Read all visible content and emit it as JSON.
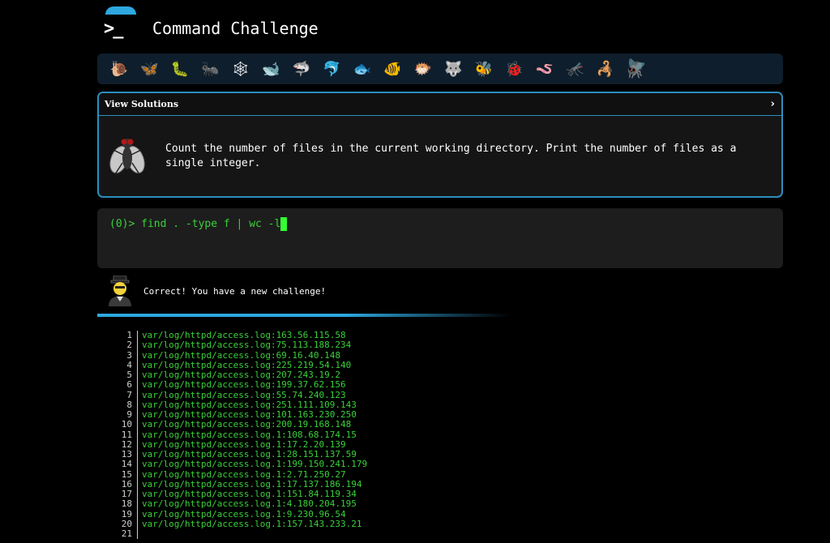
{
  "header": {
    "logo": ">_",
    "title": "Command Challenge"
  },
  "levels": [
    {
      "icon": "snail-icon",
      "glyph": "🐌"
    },
    {
      "icon": "butterfly-icon",
      "glyph": "🦋"
    },
    {
      "icon": "caterpillar-icon",
      "glyph": "🐛"
    },
    {
      "icon": "ant-icon",
      "glyph": "🐜"
    },
    {
      "icon": "web-icon",
      "glyph": "🕸"
    },
    {
      "icon": "whale-icon",
      "glyph": "🐋"
    },
    {
      "icon": "shark-icon",
      "glyph": "🦈"
    },
    {
      "icon": "dolphin-icon",
      "glyph": "🐬"
    },
    {
      "icon": "fish-icon",
      "glyph": "🐟"
    },
    {
      "icon": "tropical-fish-icon",
      "glyph": "🐠"
    },
    {
      "icon": "blowfish-icon",
      "glyph": "🐡"
    },
    {
      "icon": "wolf-icon",
      "glyph": "🐺"
    },
    {
      "icon": "bee-icon",
      "glyph": "🐝"
    },
    {
      "icon": "ladybug-icon",
      "glyph": "🐞"
    },
    {
      "icon": "worm-icon",
      "glyph": "🪱"
    },
    {
      "icon": "mosquito-icon",
      "glyph": "🦟"
    },
    {
      "icon": "scorpion-icon",
      "glyph": "🦂"
    },
    {
      "icon": "fly-icon",
      "glyph": "🪰",
      "current": true
    }
  ],
  "panel": {
    "label": "View Solutions",
    "chevron": "›",
    "challenge": "Count the number of files in the current working directory. Print the number of files as a single integer."
  },
  "terminal": {
    "prompt": "(0)> ",
    "input": "find . -type f | wc -l"
  },
  "feedback": {
    "message": "Correct! You have a new challenge!"
  },
  "output": [
    {
      "n": "1",
      "text": "var/log/httpd/access.log:163.56.115.58"
    },
    {
      "n": "2",
      "text": "var/log/httpd/access.log:75.113.188.234"
    },
    {
      "n": "3",
      "text": "var/log/httpd/access.log:69.16.40.148"
    },
    {
      "n": "4",
      "text": "var/log/httpd/access.log:225.219.54.140"
    },
    {
      "n": "5",
      "text": "var/log/httpd/access.log:207.243.19.2"
    },
    {
      "n": "6",
      "text": "var/log/httpd/access.log:199.37.62.156"
    },
    {
      "n": "7",
      "text": "var/log/httpd/access.log:55.74.240.123"
    },
    {
      "n": "8",
      "text": "var/log/httpd/access.log:251.111.109.143"
    },
    {
      "n": "9",
      "text": "var/log/httpd/access.log:101.163.230.250"
    },
    {
      "n": "10",
      "text": "var/log/httpd/access.log:200.19.168.148"
    },
    {
      "n": "11",
      "text": "var/log/httpd/access.log.1:108.68.174.15"
    },
    {
      "n": "12",
      "text": "var/log/httpd/access.log.1:17.2.20.139"
    },
    {
      "n": "13",
      "text": "var/log/httpd/access.log.1:28.151.137.59"
    },
    {
      "n": "14",
      "text": "var/log/httpd/access.log.1:199.150.241.179"
    },
    {
      "n": "15",
      "text": "var/log/httpd/access.log.1:2.71.250.27"
    },
    {
      "n": "16",
      "text": "var/log/httpd/access.log.1:17.137.186.194"
    },
    {
      "n": "17",
      "text": "var/log/httpd/access.log.1:151.84.119.34"
    },
    {
      "n": "18",
      "text": "var/log/httpd/access.log.1:4.180.204.195"
    },
    {
      "n": "19",
      "text": "var/log/httpd/access.log.1:9.230.96.54"
    },
    {
      "n": "20",
      "text": "var/log/httpd/access.log.1:157.143.233.21"
    },
    {
      "n": "21",
      "text": ""
    }
  ]
}
